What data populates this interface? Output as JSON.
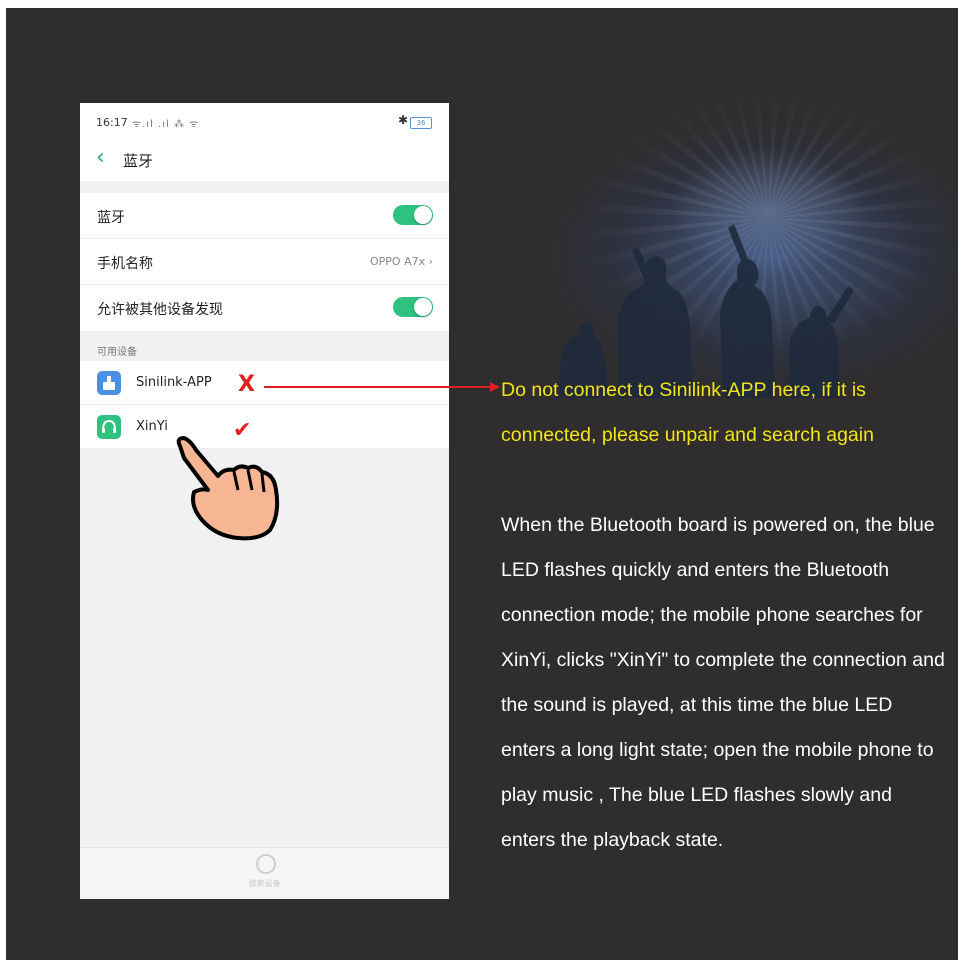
{
  "statusbar": {
    "time": "16:17",
    "signal": "ᯤ.ıl .ıl ⁂ ᯤ",
    "bluetooth_icon": "bluetooth-icon",
    "battery": "36"
  },
  "navbar": {
    "back_icon": "chevron-left-icon",
    "title": "蓝牙"
  },
  "settings": {
    "bluetooth_label": "蓝牙",
    "bluetooth_on": true,
    "phone_name_label": "手机名称",
    "phone_name_value": "OPPO A7x ›",
    "discoverable_label": "允许被其他设备发现",
    "discoverable_on": true
  },
  "available": {
    "section_label": "可用设备",
    "devices": [
      {
        "name": "Sinilink-APP",
        "icon": "sinilink-app-icon",
        "icon_color": "#4a90e2"
      },
      {
        "name": "XinYi",
        "icon": "headset-icon",
        "icon_color": "#2ec27e"
      }
    ]
  },
  "bottom": {
    "search_label": "搜索设备"
  },
  "annotations": {
    "x_mark": "X",
    "check_mark": "✔",
    "mark_color": "#e02020",
    "warning": "Do not connect to Sinilink-APP here, if it is connected, please unpair and search again",
    "warning_color": "#f3e516",
    "description": "When the Bluetooth board is powered on, the blue LED flashes quickly and enters the Bluetooth connection mode; the mobile phone searches for XinYi, clicks \"XinYi\" to complete the connection and the sound is played, at this time the blue LED enters a long light state; open the mobile phone to play music , The blue LED flashes slowly and enters the playback state."
  }
}
